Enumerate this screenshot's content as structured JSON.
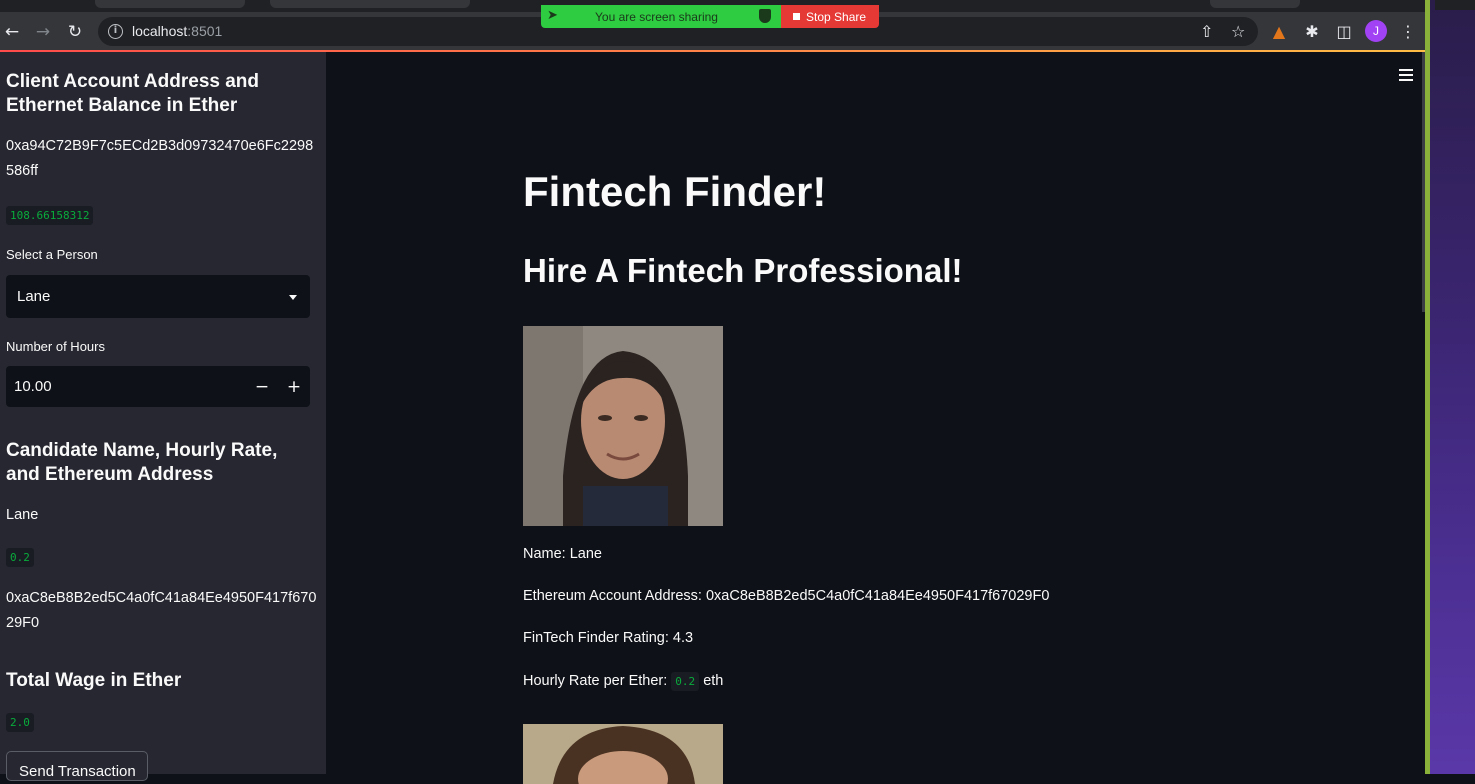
{
  "browser": {
    "url_host": "localhost",
    "url_port": ":8501"
  },
  "share_banner": {
    "message": "You are screen sharing",
    "stop_label": "Stop Share"
  },
  "sidebar": {
    "client_heading": "Client Account Address and Ethernet Balance in Ether",
    "client_address": "0xa94C72B9F7c5ECd2B3d09732470e6Fc2298586ff",
    "client_balance": "108.66158312",
    "select_person_label": "Select a Person",
    "selected_person": "Lane",
    "hours_label": "Number of Hours",
    "hours_value": "10.00",
    "candidate_heading": "Candidate Name, Hourly Rate, and Ethereum Address",
    "candidate_name": "Lane",
    "candidate_rate": "0.2",
    "candidate_address": "0xaC8eB8B2ed5C4a0fC41a84Ee4950F417f67029F0",
    "wage_heading": "Total Wage in Ether",
    "wage_value": "2.0",
    "send_button": "Send Transaction"
  },
  "main": {
    "title": "Fintech Finder!",
    "subtitle": "Hire A Fintech Professional!",
    "candidate": {
      "name_line": "Name: Lane",
      "address_line": "Ethereum Account Address: 0xaC8eB8B2ed5C4a0fC41a84Ee4950F417f67029F0",
      "rating_line": "FinTech Finder Rating: 4.3",
      "rate_prefix": "Hourly Rate per Ether:",
      "rate_value": "0.2",
      "rate_suffix": "eth"
    }
  },
  "colors": {
    "app_bg": "#0e1117",
    "sidebar_bg": "#262730",
    "code_green": "#09ab3b",
    "share_green": "#2ecc40",
    "share_red": "#e53935"
  }
}
